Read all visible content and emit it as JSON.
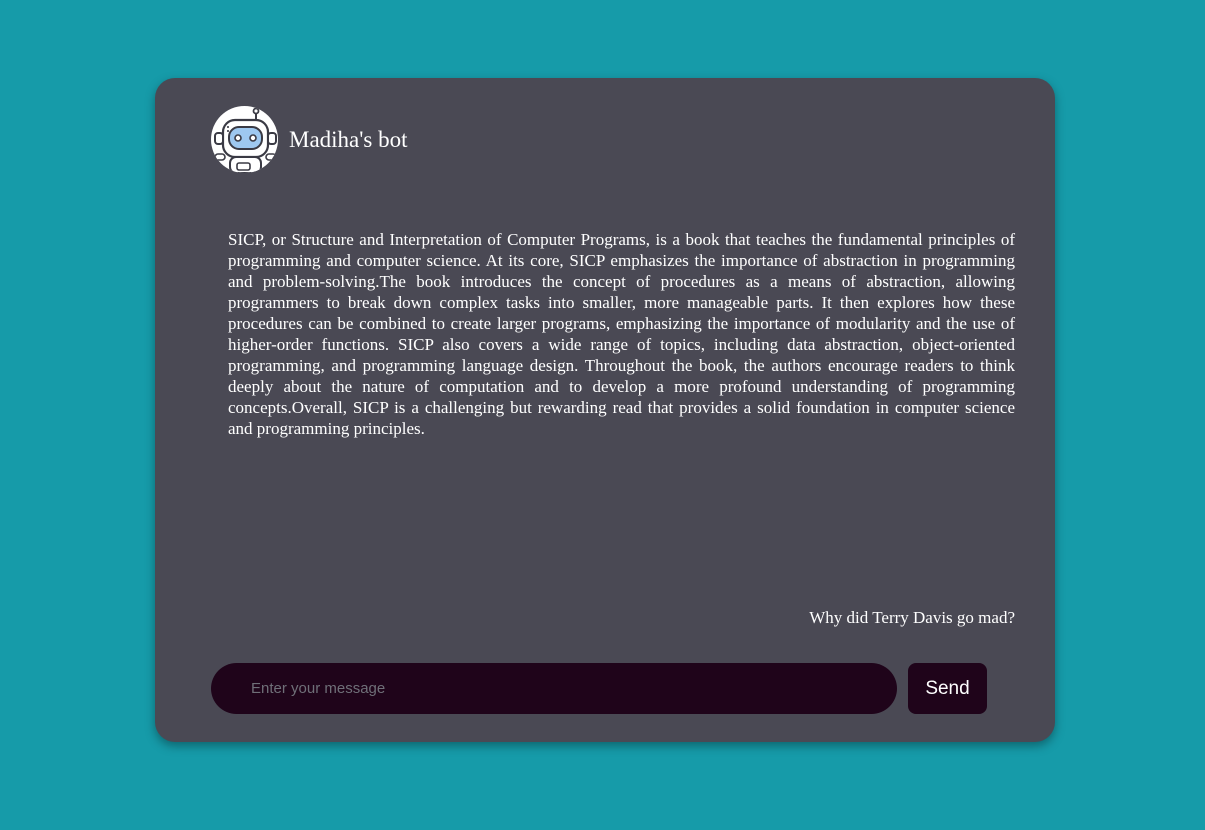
{
  "header": {
    "bot_name": "Madiha's bot",
    "avatar_icon": "robot-icon"
  },
  "messages": {
    "bot_reply": "SICP, or Structure and Interpretation of Computer Programs, is a book that teaches the fundamental principles of programming and computer science. At its core, SICP emphasizes the importance of abstraction in programming and problem-solving.The book introduces the concept of procedures as a means of abstraction, allowing programmers to break down complex tasks into smaller, more manageable parts. It then explores how these procedures can be combined to create larger programs, emphasizing the importance of modularity and the use of higher-order functions. SICP also covers a wide range of topics, including data abstraction, object-oriented programming, and programming language design. Throughout the book, the authors encourage readers to think deeply about the nature of computation and to develop a more profound understanding of programming concepts.Overall, SICP is a challenging but rewarding read that provides a solid foundation in computer science and programming principles.",
    "user_question": "Why did Terry Davis go mad?"
  },
  "composer": {
    "placeholder": "Enter your message",
    "value": "",
    "send_label": "Send"
  },
  "colors": {
    "page_background": "#169ba9",
    "chat_window": "#4a4954",
    "input_background": "#1f041a",
    "text": "#ffffff"
  }
}
